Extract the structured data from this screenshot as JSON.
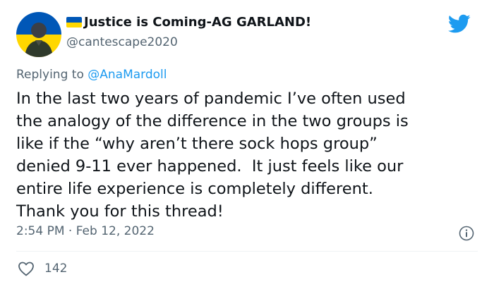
{
  "author": {
    "display_name": "Justice is Coming-AG GARLAND!",
    "handle": "@cantescape2020",
    "flag_icon": "ukraine-flag-icon",
    "avatar_colors": {
      "blue": "#0057b7",
      "yellow": "#ffd700"
    }
  },
  "reply": {
    "prefix": "Replying to ",
    "mention": "@AnaMardoll"
  },
  "tweet": {
    "text": "In the last two years of pandemic I’ve often used\nthe analogy of the difference in the two groups is\nlike if the “why aren’t there sock hops group”\ndenied 9-11 ever happened.  It just feels like our\nentire life experience is completely different.\nThank you for this thread!",
    "timestamp": "2:54 PM · Feb 12, 2022"
  },
  "engagement": {
    "likes": "142"
  },
  "icons": {
    "brand": "twitter-bird-icon",
    "info": "info-icon",
    "like": "heart-icon"
  },
  "colors": {
    "brand": "#1d9bf0",
    "secondary_text": "#536471",
    "primary_text": "#0f1419"
  }
}
